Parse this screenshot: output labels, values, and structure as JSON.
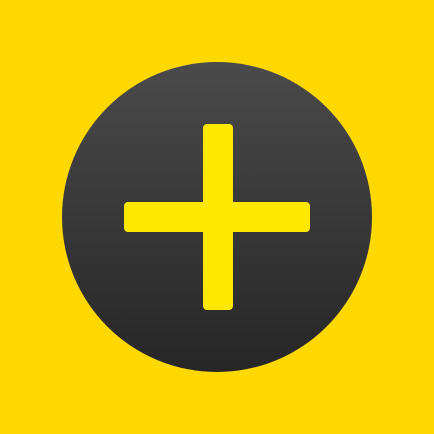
{
  "colors": {
    "background": "#FFD800",
    "button_top": "#4A4A4A",
    "button_bottom": "#262626",
    "icon": "#FFE800"
  },
  "button": {
    "icon": "plus-icon"
  }
}
